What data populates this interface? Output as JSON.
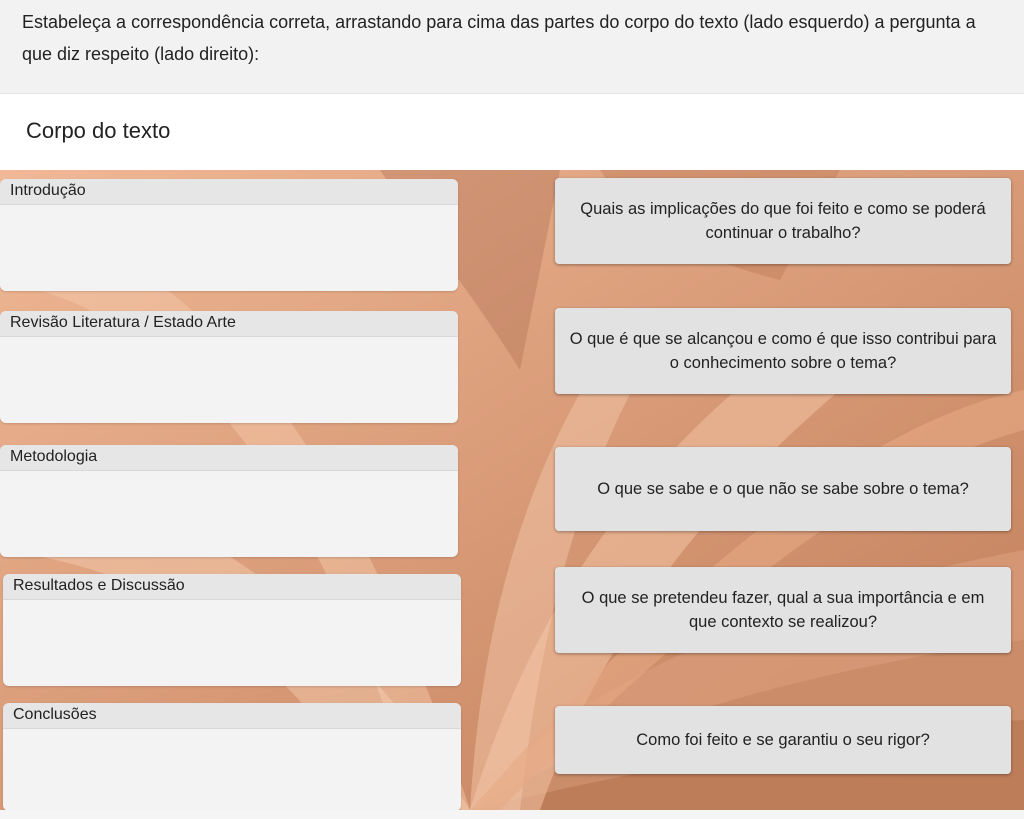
{
  "instructions": "Estabeleça a correspondência correta, arrastando para cima das partes do corpo do texto (lado esquerdo) a pergunta a que diz respeito (lado direito):",
  "section_title": "Corpo do texto",
  "dropzones": [
    {
      "label": "Introdução"
    },
    {
      "label": "Revisão Literatura / Estado Arte"
    },
    {
      "label": "Metodologia"
    },
    {
      "label": "Resultados e Discussão"
    },
    {
      "label": "Conclusões"
    }
  ],
  "cards": [
    {
      "text": "Quais as implicações do que foi feito e como se poderá continuar o trabalho?"
    },
    {
      "text": "O que é que se alcançou e como é que isso contribui para o conhecimento sobre o tema?"
    },
    {
      "text": "O que se sabe e o que não se sabe sobre o tema?"
    },
    {
      "text": "O que se pretendeu fazer, qual a sua importância e em que contexto se realizou?"
    },
    {
      "text": "Como foi  feito e se garantiu o seu rigor?"
    }
  ]
}
